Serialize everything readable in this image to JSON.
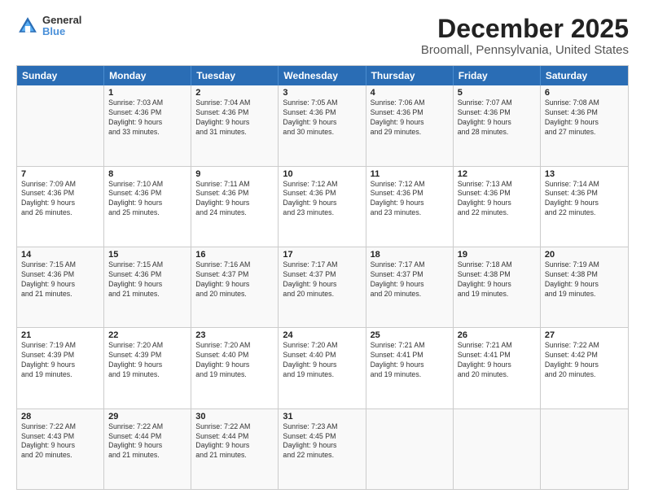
{
  "header": {
    "logo": {
      "line1": "General",
      "line2": "Blue"
    },
    "title": "December 2025",
    "subtitle": "Broomall, Pennsylvania, United States"
  },
  "calendar": {
    "weekdays": [
      "Sunday",
      "Monday",
      "Tuesday",
      "Wednesday",
      "Thursday",
      "Friday",
      "Saturday"
    ],
    "rows": [
      [
        {
          "day": "",
          "info": ""
        },
        {
          "day": "1",
          "info": "Sunrise: 7:03 AM\nSunset: 4:36 PM\nDaylight: 9 hours\nand 33 minutes."
        },
        {
          "day": "2",
          "info": "Sunrise: 7:04 AM\nSunset: 4:36 PM\nDaylight: 9 hours\nand 31 minutes."
        },
        {
          "day": "3",
          "info": "Sunrise: 7:05 AM\nSunset: 4:36 PM\nDaylight: 9 hours\nand 30 minutes."
        },
        {
          "day": "4",
          "info": "Sunrise: 7:06 AM\nSunset: 4:36 PM\nDaylight: 9 hours\nand 29 minutes."
        },
        {
          "day": "5",
          "info": "Sunrise: 7:07 AM\nSunset: 4:36 PM\nDaylight: 9 hours\nand 28 minutes."
        },
        {
          "day": "6",
          "info": "Sunrise: 7:08 AM\nSunset: 4:36 PM\nDaylight: 9 hours\nand 27 minutes."
        }
      ],
      [
        {
          "day": "7",
          "info": "Sunrise: 7:09 AM\nSunset: 4:36 PM\nDaylight: 9 hours\nand 26 minutes."
        },
        {
          "day": "8",
          "info": "Sunrise: 7:10 AM\nSunset: 4:36 PM\nDaylight: 9 hours\nand 25 minutes."
        },
        {
          "day": "9",
          "info": "Sunrise: 7:11 AM\nSunset: 4:36 PM\nDaylight: 9 hours\nand 24 minutes."
        },
        {
          "day": "10",
          "info": "Sunrise: 7:12 AM\nSunset: 4:36 PM\nDaylight: 9 hours\nand 23 minutes."
        },
        {
          "day": "11",
          "info": "Sunrise: 7:12 AM\nSunset: 4:36 PM\nDaylight: 9 hours\nand 23 minutes."
        },
        {
          "day": "12",
          "info": "Sunrise: 7:13 AM\nSunset: 4:36 PM\nDaylight: 9 hours\nand 22 minutes."
        },
        {
          "day": "13",
          "info": "Sunrise: 7:14 AM\nSunset: 4:36 PM\nDaylight: 9 hours\nand 22 minutes."
        }
      ],
      [
        {
          "day": "14",
          "info": "Sunrise: 7:15 AM\nSunset: 4:36 PM\nDaylight: 9 hours\nand 21 minutes."
        },
        {
          "day": "15",
          "info": "Sunrise: 7:15 AM\nSunset: 4:36 PM\nDaylight: 9 hours\nand 21 minutes."
        },
        {
          "day": "16",
          "info": "Sunrise: 7:16 AM\nSunset: 4:37 PM\nDaylight: 9 hours\nand 20 minutes."
        },
        {
          "day": "17",
          "info": "Sunrise: 7:17 AM\nSunset: 4:37 PM\nDaylight: 9 hours\nand 20 minutes."
        },
        {
          "day": "18",
          "info": "Sunrise: 7:17 AM\nSunset: 4:37 PM\nDaylight: 9 hours\nand 20 minutes."
        },
        {
          "day": "19",
          "info": "Sunrise: 7:18 AM\nSunset: 4:38 PM\nDaylight: 9 hours\nand 19 minutes."
        },
        {
          "day": "20",
          "info": "Sunrise: 7:19 AM\nSunset: 4:38 PM\nDaylight: 9 hours\nand 19 minutes."
        }
      ],
      [
        {
          "day": "21",
          "info": "Sunrise: 7:19 AM\nSunset: 4:39 PM\nDaylight: 9 hours\nand 19 minutes."
        },
        {
          "day": "22",
          "info": "Sunrise: 7:20 AM\nSunset: 4:39 PM\nDaylight: 9 hours\nand 19 minutes."
        },
        {
          "day": "23",
          "info": "Sunrise: 7:20 AM\nSunset: 4:40 PM\nDaylight: 9 hours\nand 19 minutes."
        },
        {
          "day": "24",
          "info": "Sunrise: 7:20 AM\nSunset: 4:40 PM\nDaylight: 9 hours\nand 19 minutes."
        },
        {
          "day": "25",
          "info": "Sunrise: 7:21 AM\nSunset: 4:41 PM\nDaylight: 9 hours\nand 19 minutes."
        },
        {
          "day": "26",
          "info": "Sunrise: 7:21 AM\nSunset: 4:41 PM\nDaylight: 9 hours\nand 20 minutes."
        },
        {
          "day": "27",
          "info": "Sunrise: 7:22 AM\nSunset: 4:42 PM\nDaylight: 9 hours\nand 20 minutes."
        }
      ],
      [
        {
          "day": "28",
          "info": "Sunrise: 7:22 AM\nSunset: 4:43 PM\nDaylight: 9 hours\nand 20 minutes."
        },
        {
          "day": "29",
          "info": "Sunrise: 7:22 AM\nSunset: 4:44 PM\nDaylight: 9 hours\nand 21 minutes."
        },
        {
          "day": "30",
          "info": "Sunrise: 7:22 AM\nSunset: 4:44 PM\nDaylight: 9 hours\nand 21 minutes."
        },
        {
          "day": "31",
          "info": "Sunrise: 7:23 AM\nSunset: 4:45 PM\nDaylight: 9 hours\nand 22 minutes."
        },
        {
          "day": "",
          "info": ""
        },
        {
          "day": "",
          "info": ""
        },
        {
          "day": "",
          "info": ""
        }
      ]
    ]
  }
}
